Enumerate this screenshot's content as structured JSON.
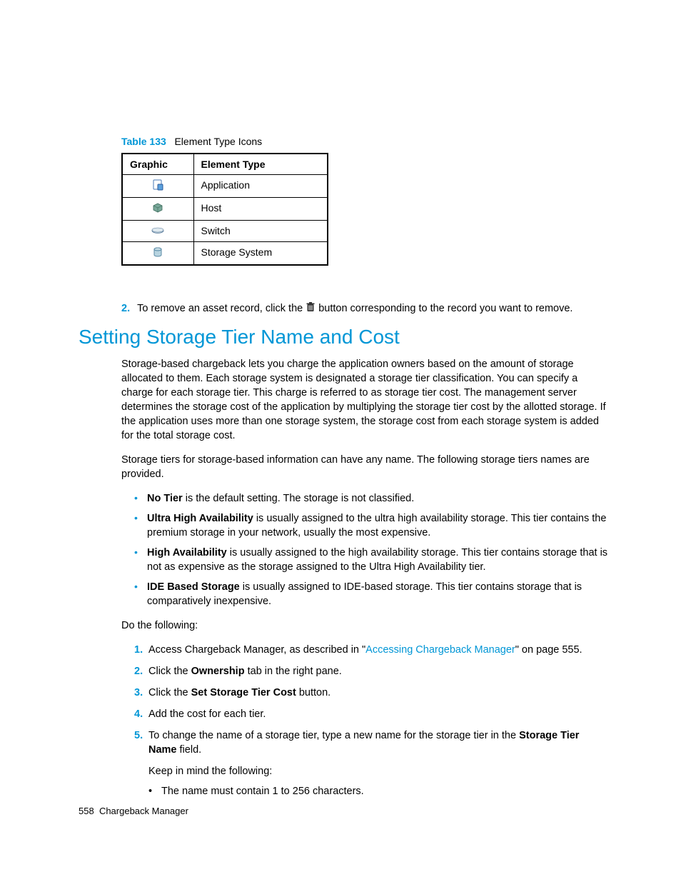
{
  "table": {
    "caption_num": "Table 133",
    "caption_text": "Element Type Icons",
    "headers": {
      "col1": "Graphic",
      "col2": "Element Type"
    },
    "rows": [
      {
        "type": "Application"
      },
      {
        "type": "Host"
      },
      {
        "type": "Switch"
      },
      {
        "type": "Storage System"
      }
    ]
  },
  "step_remove": {
    "num": "2.",
    "before": "To remove an asset record, click the",
    "after": "button corresponding to the record you want to remove."
  },
  "heading": "Setting Storage Tier Name and Cost",
  "para1": "Storage-based chargeback lets you charge the application owners based on the amount of storage allocated to them. Each storage system is designated a storage tier classification. You can specify a charge for each storage tier. This charge is referred to as storage tier cost. The management server determines the storage cost of the application by multiplying the storage tier cost by the allotted storage. If the application uses more than one storage system, the storage cost from each storage system is added for the total storage cost.",
  "para2": "Storage tiers for storage-based information can have any name. The following storage tiers names are provided.",
  "bullets": [
    {
      "bold": "No Tier",
      "text": " is the default setting. The storage is not classified."
    },
    {
      "bold": "Ultra High Availability",
      "text": " is usually assigned to the ultra high availability storage. This tier contains the premium storage in your network, usually the most expensive."
    },
    {
      "bold": "High Availability",
      "text": " is usually assigned to the high availability storage. This tier contains storage that is not as expensive as the storage assigned to the Ultra High Availability tier."
    },
    {
      "bold": "IDE Based Storage",
      "text": " is usually assigned to IDE-based storage. This tier contains storage that is comparatively inexpensive."
    }
  ],
  "do_following": "Do the following:",
  "steps": [
    {
      "num": "1.",
      "pre": "Access Chargeback Manager, as described in \"",
      "link": "Accessing Chargeback Manager",
      "post": "\" on page 555."
    },
    {
      "num": "2.",
      "pre": "Click the ",
      "bold": "Ownership",
      "post": " tab in the right pane."
    },
    {
      "num": "3.",
      "pre": "Click the ",
      "bold": "Set Storage Tier Cost",
      "post": " button."
    },
    {
      "num": "4.",
      "pre": "Add the cost for each tier."
    },
    {
      "num": "5.",
      "pre": "To change the name of a storage tier, type a new name for the storage tier in the ",
      "bold": "Storage Tier Name",
      "post": " field.",
      "sub_body": "Keep in mind the following:",
      "sub_bullets": [
        "The name must contain 1 to 256 characters."
      ]
    }
  ],
  "footer": {
    "page": "558",
    "title": "Chargeback Manager"
  }
}
